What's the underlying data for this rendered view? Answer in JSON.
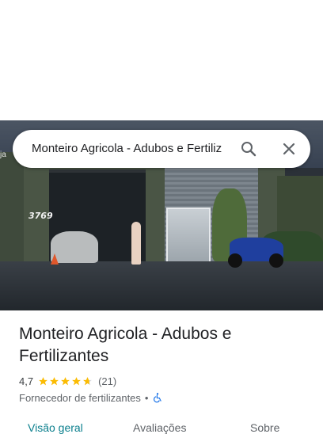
{
  "search": {
    "query": "Monteiro Agricola - Adubos e Fertiliz"
  },
  "photo": {
    "edge_label": "ja",
    "building_number": "3769"
  },
  "place": {
    "title": "Monteiro Agricola - Adubos e Fertilizantes",
    "rating": "4,7",
    "stars": 4.7,
    "review_count": "(21)",
    "category": "Fornecedor de fertilizantes",
    "separator": "•",
    "accessibility": "wheelchair-icon"
  },
  "tabs": [
    {
      "label": "Visão geral",
      "active": true
    },
    {
      "label": "Avaliações",
      "active": false
    },
    {
      "label": "Sobre",
      "active": false
    }
  ],
  "colors": {
    "accent": "#0b7f8d",
    "star": "#fbbc04",
    "accessibility": "#1a73e8"
  }
}
